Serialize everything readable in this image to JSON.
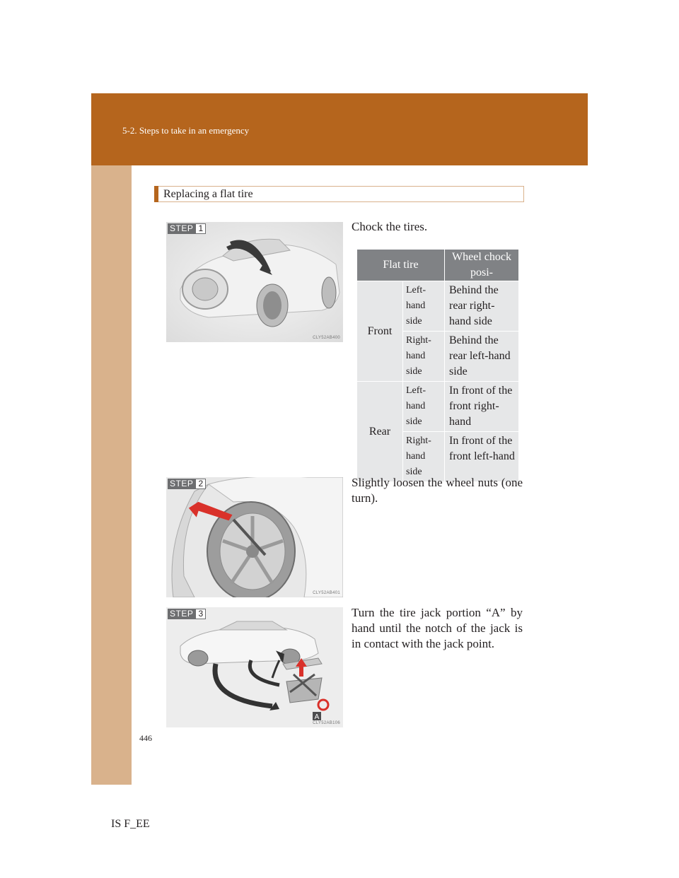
{
  "header": {
    "section": "5-2. Steps to take in an emergency"
  },
  "section_title": "Replacing a flat tire",
  "steps": [
    {
      "label": "STEP",
      "number": "1",
      "text": "Chock the tires.",
      "figure_code": "CLY52AB400",
      "figure_icon": "car-front-hood-open-icon"
    },
    {
      "label": "STEP",
      "number": "2",
      "text": "Slightly loosen the wheel nuts (one turn).",
      "figure_code": "CLY52AB401",
      "figure_icon": "wheel-nut-loosen-icon"
    },
    {
      "label": "STEP",
      "number": "3",
      "text": "Turn the tire jack portion “A” by hand until the notch of the jack is in contact with the jack point.",
      "figure_code": "CLY52AB106",
      "figure_icon": "tire-jack-icon",
      "callout": "A"
    }
  ],
  "chock_table": {
    "headers": [
      "Flat tire",
      "Wheel chock posi-"
    ],
    "rows": [
      {
        "position": "Front",
        "side": "Left-hand side",
        "chock": "Behind the rear right-hand side"
      },
      {
        "position": "",
        "side": "Right-hand side",
        "chock": "Behind the rear left-hand side"
      },
      {
        "position": "Rear",
        "side": "Left-hand side",
        "chock": "In front of the front right-hand"
      },
      {
        "position": "",
        "side": "Right-hand side",
        "chock": "In front of the front left-hand"
      }
    ]
  },
  "footer": {
    "page_number": "446",
    "model": "IS F_EE"
  },
  "colors": {
    "accent": "#b5651d",
    "sidebar": "#d9b28c",
    "table_header": "#808285",
    "table_cell": "#e6e7e8"
  }
}
